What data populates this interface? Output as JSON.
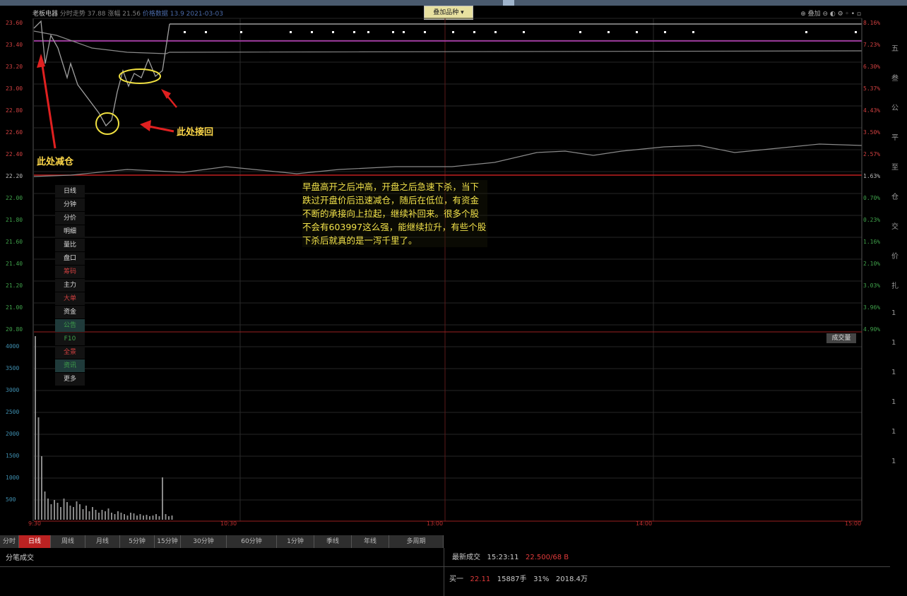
{
  "header": {
    "stock": "老板电器",
    "info": "分时走势 37.88 涨幅 21.56",
    "link": "价格数据 13.9 2021-03-03",
    "center_tag": "叠加品种 ▾",
    "tools": "⊕ 叠加 ⊖ ◐ ⚙ ◦ • ▫"
  },
  "left_axis": {
    "price_labels": [
      "23.60",
      "23.40",
      "23.20",
      "23.00",
      "22.80",
      "22.60",
      "22.40",
      "22.20",
      "22.00",
      "21.80",
      "21.60",
      "21.40",
      "21.20",
      "21.00",
      "20.80"
    ],
    "volume_labels": [
      "4000",
      "3500",
      "3000",
      "2500",
      "2000",
      "1500",
      "1000",
      "500"
    ]
  },
  "right_axis": {
    "pct_labels": [
      "8.16%",
      "7.23%",
      "6.30%",
      "5.37%",
      "4.43%",
      "3.50%",
      "2.57%",
      "1.63%",
      "0.70%",
      "0.23%",
      "1.16%",
      "2.10%",
      "3.03%",
      "3.96%",
      "4.90%"
    ],
    "far_right": [
      "五",
      "叁",
      "公",
      "平",
      "至",
      "仓",
      "交",
      "价",
      "扎",
      "1",
      "1",
      "1",
      "1",
      "1",
      "1"
    ]
  },
  "annotations": {
    "reduce": "此处减仓",
    "buyback": "此处接回"
  },
  "note": "早盘高开之后冲高，开盘之后急速下杀，当下跌过开盘价后迅速减仓，随后在低位，有资金不断的承接向上拉起，继续补回来。很多个股不会有603997这么强，能继续拉升，有些个股下杀后就真的是一泻千里了。",
  "side_panel": [
    "日线",
    "分钟",
    "分价",
    "明细",
    "量比",
    "盘口",
    "筹码",
    "主力",
    "大单",
    "资金",
    "公告",
    "F10",
    "全景",
    "资讯",
    "更多"
  ],
  "volume_badge": "成交量",
  "time_axis": [
    "9:30",
    "10:30",
    "13:00",
    "14:00",
    "15:00"
  ],
  "tabs": [
    "分时",
    "日线",
    "周线",
    "月线",
    "5分钟",
    "15分钟",
    "30分钟",
    "60分钟",
    "1分钟",
    "季线",
    "年线",
    "多周期"
  ],
  "bottom": {
    "left": "分笔成交",
    "quote1_label": "最新成交",
    "quote1_time": "15:23:11",
    "quote1_red": "22.500/68 B",
    "quote2_label": "买一",
    "quote2_price": "22.11",
    "quote2_vol": "15887手",
    "quote2_pct": "31%",
    "quote2_amt": "2018.4万"
  },
  "colors": {
    "price_line": "#9a9a9a",
    "avg_line": "#e0c040",
    "baseline": "#c02020",
    "note_text": "#f2e24a",
    "arrow": "#e02020"
  }
}
